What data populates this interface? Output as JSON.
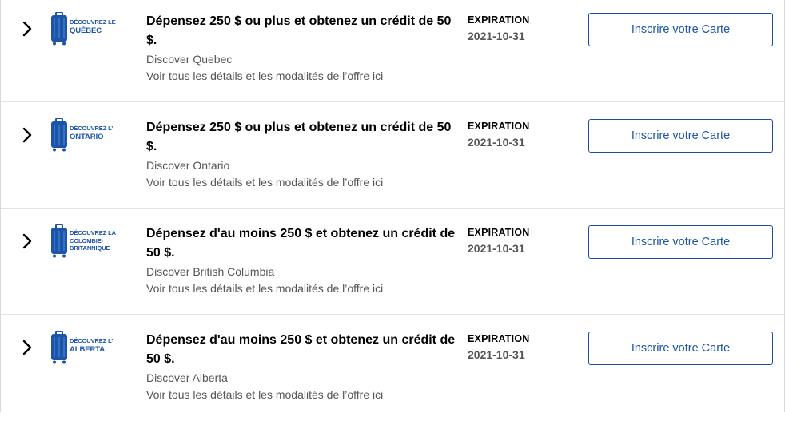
{
  "colors": {
    "brand_blue": "#1c55a8",
    "button_border": "#1c4f9c",
    "secondary_text": "#555555",
    "divider": "#e3e3e3"
  },
  "offers": [
    {
      "logo_line1": "DÉCOUVREZ LE",
      "logo_line2": "QUÉBEC",
      "logo_icon": "suitcase-icon",
      "title": "Dépensez 250 $ ou plus et obtenez un crédit de 50 $.",
      "merchant": "Discover Quebec",
      "details_link": "Voir tous les détails et les modalités de l’offre ici",
      "expiry_label": "EXPIRATION",
      "expiry_date": "2021-10-31",
      "enroll_label": "Inscrire votre Carte"
    },
    {
      "logo_line1": "DÉCOUVREZ L’",
      "logo_line2": "ONTARIO",
      "logo_icon": "suitcase-icon",
      "title": "Dépensez 250 $ ou plus et obtenez un crédit de 50 $.",
      "merchant": "Discover Ontario",
      "details_link": "Voir tous les détails et les modalités de l’offre ici",
      "expiry_label": "EXPIRATION",
      "expiry_date": "2021-10-31",
      "enroll_label": "Inscrire votre Carte"
    },
    {
      "logo_line1": "DÉCOUVREZ LA",
      "logo_line2": "COLOMBIE-",
      "logo_line3": "BRITANNIQUE",
      "logo_icon": "suitcase-icon",
      "title": "Dépensez d'au moins 250 $ et obtenez un crédit de 50 $.",
      "merchant": "Discover British Columbia",
      "details_link": "Voir tous les détails et les modalités de l’offre ici",
      "expiry_label": "EXPIRATION",
      "expiry_date": "2021-10-31",
      "enroll_label": "Inscrire votre Carte"
    },
    {
      "logo_line1": "DÉCOUVREZ L’",
      "logo_line2": "ALBERTA",
      "logo_icon": "suitcase-icon",
      "title": "Dépensez d'au moins 250 $ et obtenez un crédit de 50 $.",
      "merchant": "Discover Alberta",
      "details_link": "Voir tous les détails et les modalités de l’offre ici",
      "expiry_label": "EXPIRATION",
      "expiry_date": "2021-10-31",
      "enroll_label": "Inscrire votre Carte"
    }
  ]
}
